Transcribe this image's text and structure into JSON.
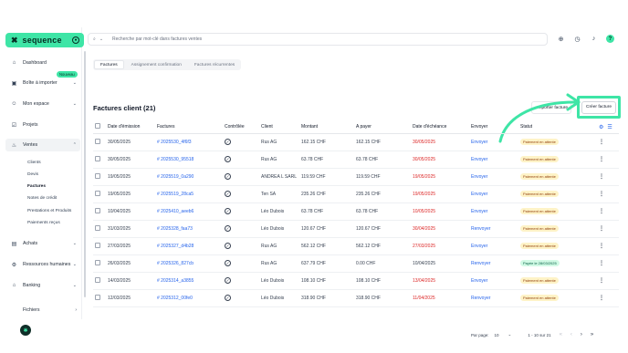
{
  "brand": {
    "name": "sequence",
    "accent": "#3ee5a6"
  },
  "search": {
    "placeholder": "Recherche par mot-clé dans factures ventes"
  },
  "sidebar": {
    "items": [
      {
        "label": "Dashboard",
        "icon": "home-icon"
      },
      {
        "label": "Boîte à importer",
        "icon": "inbox-icon"
      },
      {
        "label": "Mon espace",
        "icon": "user-icon"
      },
      {
        "label": "Projets",
        "icon": "checkbox-icon"
      },
      {
        "label": "Ventes",
        "icon": "flame-icon"
      },
      {
        "label": "Achats",
        "icon": "bag-icon"
      },
      {
        "label": "Ressources humaines",
        "icon": "gear-icon"
      },
      {
        "label": "Banking",
        "icon": "bank-icon"
      },
      {
        "label": "Fichiers",
        "icon": "folder-icon"
      }
    ],
    "new_badge": "Nouveau",
    "ventes_sub": [
      "Clients",
      "Devis",
      "Factures",
      "Notes de crédit",
      "Prestations et Produits",
      "Paiements reçus"
    ]
  },
  "tabs": [
    "Factures",
    "Assignement confirmation",
    "Factures récurrentes"
  ],
  "page": {
    "title": "Factures client (21)",
    "ghost_button": "Importer facture",
    "create_button": "Créer facture"
  },
  "table": {
    "headers": [
      "Date d'émission",
      "Factures",
      "Contrôlée",
      "Client",
      "Montant",
      "A payer",
      "Date d'échéance",
      "Envoyer",
      "Statut"
    ],
    "rows": [
      {
        "date": "30/05/2025",
        "invoice": "# 2025530_4f6f3",
        "client": "Rus AG",
        "amount": "162.15 CHF",
        "topay": "162.15 CHF",
        "due": "30/05/2025",
        "due_red": true,
        "send": "Envoyer",
        "status": "Paiement en attente",
        "paid": false
      },
      {
        "date": "30/05/2025",
        "invoice": "# 2025530_95518",
        "client": "Rus AG",
        "amount": "63.78 CHF",
        "topay": "63.78 CHF",
        "due": "30/05/2025",
        "due_red": true,
        "send": "Envoyer",
        "status": "Paiement en attente",
        "paid": false
      },
      {
        "date": "19/05/2025",
        "invoice": "# 2025519_0a290",
        "client": "ANDREA L SARL",
        "amount": "119.59 CHF",
        "topay": "119.59 CHF",
        "due": "19/05/2025",
        "due_red": true,
        "send": "Envoyer",
        "status": "Paiement en attente",
        "paid": false
      },
      {
        "date": "19/05/2025",
        "invoice": "# 2025519_28ca5",
        "client": "Ten SA",
        "amount": "235.26 CHF",
        "topay": "235.26 CHF",
        "due": "19/05/2025",
        "due_red": true,
        "send": "Envoyer",
        "status": "Paiement en attente",
        "paid": false
      },
      {
        "date": "10/04/2025",
        "invoice": "# 2025410_aeeb6",
        "client": "Léo Dubois",
        "amount": "63.78 CHF",
        "topay": "63.78 CHF",
        "due": "10/05/2025",
        "due_red": true,
        "send": "Envoyer",
        "status": "Paiement en attente",
        "paid": false
      },
      {
        "date": "31/03/2025",
        "invoice": "# 2025328_faa73",
        "client": "Léo Dubois",
        "amount": "120.67 CHF",
        "topay": "120.67 CHF",
        "due": "30/04/2025",
        "due_red": true,
        "send": "Renvoyer",
        "status": "Paiement en attente",
        "paid": false
      },
      {
        "date": "27/03/2025",
        "invoice": "# 2025327_d4b28",
        "client": "Rus AG",
        "amount": "562.12 CHF",
        "topay": "562.12 CHF",
        "due": "27/03/2025",
        "due_red": true,
        "send": "Envoyer",
        "status": "Paiement en attente",
        "paid": false
      },
      {
        "date": "26/03/2025",
        "invoice": "# 2025326_827cb",
        "client": "Rus AG",
        "amount": "637.79 CHF",
        "topay": "0.00 CHF",
        "due": "10/04/2025",
        "due_red": false,
        "send": "Renvoyer",
        "status": "Payée le 28/03/2025",
        "paid": true
      },
      {
        "date": "14/03/2025",
        "invoice": "# 2025314_a3855",
        "client": "Léo Dubois",
        "amount": "108.10 CHF",
        "topay": "108.10 CHF",
        "due": "13/04/2025",
        "due_red": true,
        "send": "Envoyer",
        "status": "Paiement en attente",
        "paid": false
      },
      {
        "date": "12/03/2025",
        "invoice": "# 2025312_00fe0",
        "client": "Léo Dubois",
        "amount": "318.90 CHF",
        "topay": "318.90 CHF",
        "due": "11/04/2025",
        "due_red": true,
        "send": "Renvoyer",
        "status": "Paiement en attente",
        "paid": false
      }
    ]
  },
  "pager": {
    "label": "Par page:",
    "per_page": "10",
    "range": "1 - 10 sur 21"
  }
}
